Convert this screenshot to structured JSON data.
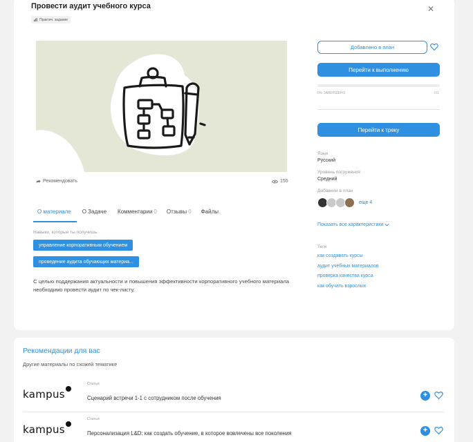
{
  "header": {
    "title": "Провести аудит учебного курса",
    "type_badge": "Практич. задание"
  },
  "media": {
    "recommend_label": "Рекомендовать",
    "views": "155"
  },
  "tabs": [
    {
      "label": "О материале",
      "count": ""
    },
    {
      "label": "О Задаче",
      "count": ""
    },
    {
      "label": "Комментарии",
      "count": "0"
    },
    {
      "label": "Отзывы",
      "count": "0"
    },
    {
      "label": "Файлы",
      "count": ""
    }
  ],
  "about": {
    "skills_label": "Навыки, которые ты получишь",
    "skills": [
      "управление корпоративным обучением",
      "проведение аудита обучающих материа..."
    ],
    "description": "С целью поддержания актуальности и повышения эффективности корпоративного учебного материала необходимо провести аудит по чек-листу."
  },
  "sidebar": {
    "added_button": "Добавлено в план",
    "go_button": "Перейти к выполнению",
    "progress_left": "0% ЗАВЕРШЕНО",
    "progress_right": "0/1",
    "progress_value": 0,
    "track_button": "Перейти к треку",
    "language_label": "Язык",
    "language_value": "Русский",
    "level_label": "Уровень погружения",
    "level_value": "Средний",
    "added_label": "Добавили в план",
    "more_users": "еще 4",
    "show_all": "Показать все характеристики",
    "tags_label": "Теги",
    "tags": [
      "как создавать курсы",
      "аудит учебных материалов",
      "проверка качества курса",
      "как обучать взрослых"
    ]
  },
  "recommendations": {
    "title": "Рекомендации для вас",
    "subtitle": "Другие материалы по схожей тематике",
    "items": [
      {
        "logo": "kampus",
        "type": "Статья",
        "title": "Сценарий встречи 1-1 с сотрудником после обучения"
      },
      {
        "logo": "kampus",
        "type": "Статья",
        "title": "Персонализация L&D: как создать обучение, в которое вовлечены все поколения"
      }
    ]
  },
  "colors": {
    "accent": "#2f8fe0",
    "cover_bg": "#e4e6d6"
  },
  "icons": {
    "close": "close-icon",
    "heart": "heart-icon",
    "share": "share-icon",
    "eye": "eye-icon",
    "plus": "plus-icon",
    "chevron": "chevron-down-icon"
  }
}
